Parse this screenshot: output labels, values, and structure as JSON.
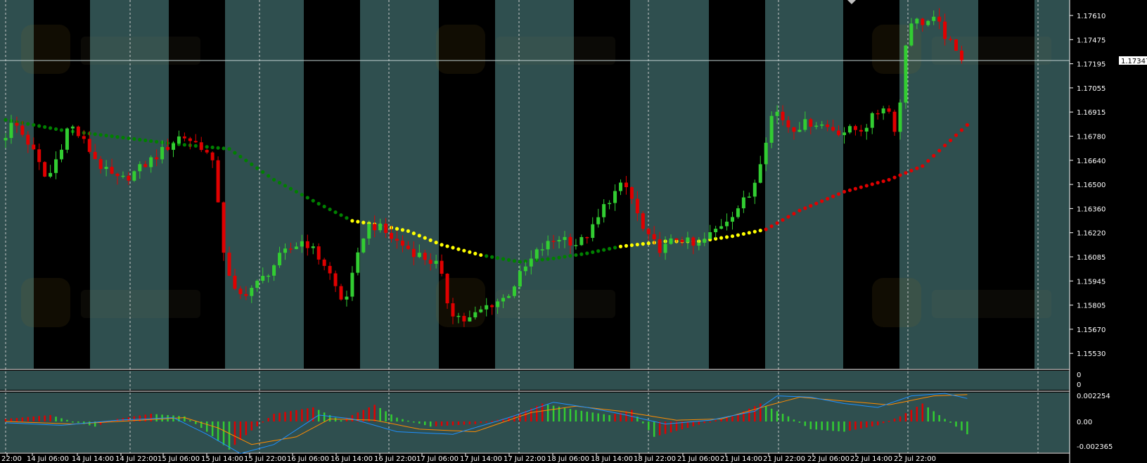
{
  "colors": {
    "background": "#000000",
    "band": "#2f4f4f",
    "grid": "#c8c8c8",
    "bull_candle": "#32cd32",
    "bear_candle": "#e00000",
    "ma_green": "#008000",
    "ma_yellow": "#ffff00",
    "ma_red": "#e00000",
    "macd_blue": "#1e90ff",
    "macd_orange": "#ff8c00",
    "axis_text": "#ffffff"
  },
  "main_chart": {
    "current_price": "1.17347",
    "price_labels": [
      "1.17610",
      "1.17475",
      "1.17195",
      "1.17055",
      "1.16915",
      "1.16780",
      "1.16640",
      "1.16500",
      "1.16360",
      "1.16220",
      "1.16085",
      "1.15945",
      "1.15805",
      "1.15670",
      "1.15530"
    ]
  },
  "sub_window_1": {
    "labels": [
      "0",
      "0"
    ]
  },
  "sub_window_2": {
    "labels": [
      "0.002254",
      "0.00",
      "-0.002365"
    ]
  },
  "time_axis": {
    "labels": [
      "22:00",
      "14 Jul 06:00",
      "14 Jul 14:00",
      "14 Jul 22:00",
      "15 Jul 06:00",
      "15 Jul 14:00",
      "15 Jul 22:00",
      "16 Jul 06:00",
      "16 Jul 14:00",
      "16 Jul 22:00",
      "17 Jul 06:00",
      "17 Jul 14:00",
      "17 Jul 22:00",
      "18 Jul 06:00",
      "18 Jul 14:00",
      "18 Jul 22:00",
      "21 Jul 06:00",
      "21 Jul 14:00",
      "21 Jul 22:00",
      "22 Jul 06:00",
      "22 Jul 14:00",
      "22 Jul 22:00"
    ]
  },
  "chart_data": {
    "type": "candlestick",
    "symbol_unit": "price",
    "ylim": [
      1.1553,
      1.1768
    ],
    "time_labels": [
      "22:00",
      "14 Jul 06:00",
      "14 Jul 14:00",
      "14 Jul 22:00",
      "15 Jul 06:00",
      "15 Jul 14:00",
      "15 Jul 22:00",
      "16 Jul 06:00",
      "16 Jul 14:00",
      "16 Jul 22:00",
      "17 Jul 06:00",
      "17 Jul 14:00",
      "17 Jul 22:00",
      "18 Jul 06:00",
      "18 Jul 14:00",
      "18 Jul 22:00",
      "21 Jul 06:00",
      "21 Jul 14:00",
      "21 Jul 22:00",
      "22 Jul 06:00",
      "22 Jul 14:00",
      "22 Jul 22:00"
    ],
    "candle_keypoints": [
      [
        0,
        1.1686,
        1
      ],
      [
        2,
        1.1697,
        1
      ],
      [
        5,
        1.1683,
        -1
      ],
      [
        8,
        1.1662,
        -1
      ],
      [
        10,
        1.1678,
        1
      ],
      [
        12,
        1.1696,
        1
      ],
      [
        15,
        1.1683,
        -1
      ],
      [
        18,
        1.1669,
        -1
      ],
      [
        21,
        1.1662,
        -1
      ],
      [
        24,
        1.1668,
        1
      ],
      [
        28,
        1.1678,
        1
      ],
      [
        32,
        1.1689,
        1
      ],
      [
        36,
        1.1682,
        -1
      ],
      [
        38,
        1.1669,
        -1
      ],
      [
        40,
        1.161,
        -1
      ],
      [
        42,
        1.1594,
        -1
      ],
      [
        46,
        1.1603,
        1
      ],
      [
        50,
        1.1619,
        1
      ],
      [
        54,
        1.1628,
        1
      ],
      [
        58,
        1.1612,
        -1
      ],
      [
        61,
        1.159,
        -1
      ],
      [
        63,
        1.161,
        1
      ],
      [
        65,
        1.1636,
        1
      ],
      [
        67,
        1.1636,
        1
      ],
      [
        70,
        1.1628,
        -1
      ],
      [
        74,
        1.162,
        -1
      ],
      [
        78,
        1.1613,
        -1
      ],
      [
        80,
        1.1587,
        -1
      ],
      [
        83,
        1.158,
        -1
      ],
      [
        87,
        1.159,
        1
      ],
      [
        90,
        1.1594,
        1
      ],
      [
        93,
        1.1609,
        1
      ],
      [
        96,
        1.1622,
        1
      ],
      [
        100,
        1.163,
        1
      ],
      [
        103,
        1.1625,
        -1
      ],
      [
        106,
        1.1636,
        1
      ],
      [
        108,
        1.165,
        1
      ],
      [
        111,
        1.166,
        1
      ],
      [
        112,
        1.1657,
        -1
      ],
      [
        115,
        1.163,
        -1
      ],
      [
        118,
        1.1622,
        -1
      ],
      [
        121,
        1.163,
        1
      ],
      [
        124,
        1.1623,
        -1
      ],
      [
        128,
        1.1635,
        1
      ],
      [
        131,
        1.1645,
        1
      ],
      [
        134,
        1.1655,
        1
      ],
      [
        136,
        1.168,
        1
      ],
      [
        138,
        1.1705,
        1
      ],
      [
        141,
        1.1693,
        -1
      ],
      [
        145,
        1.1697,
        1
      ],
      [
        150,
        1.1691,
        -1
      ],
      [
        154,
        1.1693,
        1
      ],
      [
        158,
        1.1708,
        1
      ],
      [
        160,
        1.169,
        -1
      ],
      [
        161,
        1.172,
        1
      ],
      [
        162,
        1.1757,
        1
      ],
      [
        164,
        1.1755,
        -1
      ],
      [
        167,
        1.1756,
        1
      ],
      [
        170,
        1.174,
        -1
      ],
      [
        171,
        1.1735,
        -1
      ]
    ],
    "moving_average": {
      "keypoints": [
        [
          0,
          1.1698
        ],
        [
          10,
          1.1692
        ],
        [
          30,
          1.1684
        ],
        [
          40,
          1.1681
        ],
        [
          48,
          1.1663
        ],
        [
          56,
          1.1649
        ],
        [
          62,
          1.1639
        ],
        [
          66,
          1.1637
        ],
        [
          72,
          1.1633
        ],
        [
          78,
          1.1625
        ],
        [
          85,
          1.1619
        ],
        [
          92,
          1.1615
        ],
        [
          98,
          1.1617
        ],
        [
          104,
          1.162
        ],
        [
          110,
          1.1624
        ],
        [
          118,
          1.1627
        ],
        [
          124,
          1.1627
        ],
        [
          130,
          1.163
        ],
        [
          136,
          1.1634
        ],
        [
          142,
          1.1645
        ],
        [
          150,
          1.1656
        ],
        [
          158,
          1.1663
        ],
        [
          164,
          1.1671
        ],
        [
          172,
          1.1695
        ]
      ],
      "color_segments": [
        {
          "from": 0,
          "to": 62,
          "color": "green"
        },
        {
          "from": 62,
          "to": 86,
          "color": "yellow"
        },
        {
          "from": 86,
          "to": 110,
          "color": "green"
        },
        {
          "from": 110,
          "to": 136,
          "color": "yellow"
        },
        {
          "from": 136,
          "to": 172,
          "color": "red"
        }
      ]
    },
    "macd": {
      "ylim": [
        -0.002365,
        0.002254
      ],
      "histogram_keypoints": [
        [
          0,
          0.0002
        ],
        [
          8,
          0.0005
        ],
        [
          12,
          0.0
        ],
        [
          16,
          -0.0004
        ],
        [
          20,
          0.0002
        ],
        [
          26,
          0.0006
        ],
        [
          32,
          0.0004
        ],
        [
          36,
          -0.0008
        ],
        [
          40,
          -0.0022
        ],
        [
          44,
          -0.0007
        ],
        [
          48,
          0.0006
        ],
        [
          55,
          0.0011
        ],
        [
          60,
          0.0001
        ],
        [
          66,
          0.0013
        ],
        [
          70,
          0.0003
        ],
        [
          76,
          -0.0004
        ],
        [
          84,
          -0.0002
        ],
        [
          90,
          0.0003
        ],
        [
          96,
          0.0014
        ],
        [
          102,
          0.0009
        ],
        [
          108,
          0.0005
        ],
        [
          112,
          0.0009
        ],
        [
          116,
          -0.0012
        ],
        [
          122,
          -0.0005
        ],
        [
          126,
          0.0
        ],
        [
          130,
          0.0004
        ],
        [
          135,
          0.0014
        ],
        [
          140,
          0.0004
        ],
        [
          144,
          -0.0006
        ],
        [
          150,
          -0.0008
        ],
        [
          156,
          -0.0003
        ],
        [
          160,
          0.0004
        ],
        [
          164,
          0.0014
        ],
        [
          168,
          0.0002
        ],
        [
          172,
          -0.001
        ]
      ],
      "signal_blue_keypoints": [
        [
          0,
          -0.0001
        ],
        [
          10,
          -0.0003
        ],
        [
          20,
          0.0001
        ],
        [
          30,
          0.0003
        ],
        [
          36,
          -0.001
        ],
        [
          42,
          -0.0025
        ],
        [
          48,
          -0.0018
        ],
        [
          56,
          0.0005
        ],
        [
          62,
          0.0002
        ],
        [
          70,
          -0.0008
        ],
        [
          80,
          -0.001
        ],
        [
          90,
          0.0003
        ],
        [
          98,
          0.0015
        ],
        [
          104,
          0.0011
        ],
        [
          110,
          0.0006
        ],
        [
          118,
          -0.0002
        ],
        [
          126,
          0.0001
        ],
        [
          134,
          0.0008
        ],
        [
          138,
          0.002
        ],
        [
          144,
          0.0019
        ],
        [
          150,
          0.0014
        ],
        [
          156,
          0.0011
        ],
        [
          162,
          0.002
        ],
        [
          168,
          0.0022
        ],
        [
          172,
          0.0018
        ]
      ],
      "signal_orange_keypoints": [
        [
          0,
          0.0
        ],
        [
          12,
          -0.0002
        ],
        [
          24,
          0.0001
        ],
        [
          32,
          0.0003
        ],
        [
          38,
          -0.0005
        ],
        [
          44,
          -0.0018
        ],
        [
          52,
          -0.0012
        ],
        [
          58,
          0.0002
        ],
        [
          66,
          0.0001
        ],
        [
          74,
          -0.0006
        ],
        [
          84,
          -0.0008
        ],
        [
          94,
          0.0007
        ],
        [
          102,
          0.0012
        ],
        [
          110,
          0.0008
        ],
        [
          120,
          0.0001
        ],
        [
          128,
          0.0002
        ],
        [
          136,
          0.0012
        ],
        [
          142,
          0.0019
        ],
        [
          150,
          0.0016
        ],
        [
          158,
          0.0013
        ],
        [
          166,
          0.002
        ],
        [
          172,
          0.0021
        ]
      ]
    }
  }
}
